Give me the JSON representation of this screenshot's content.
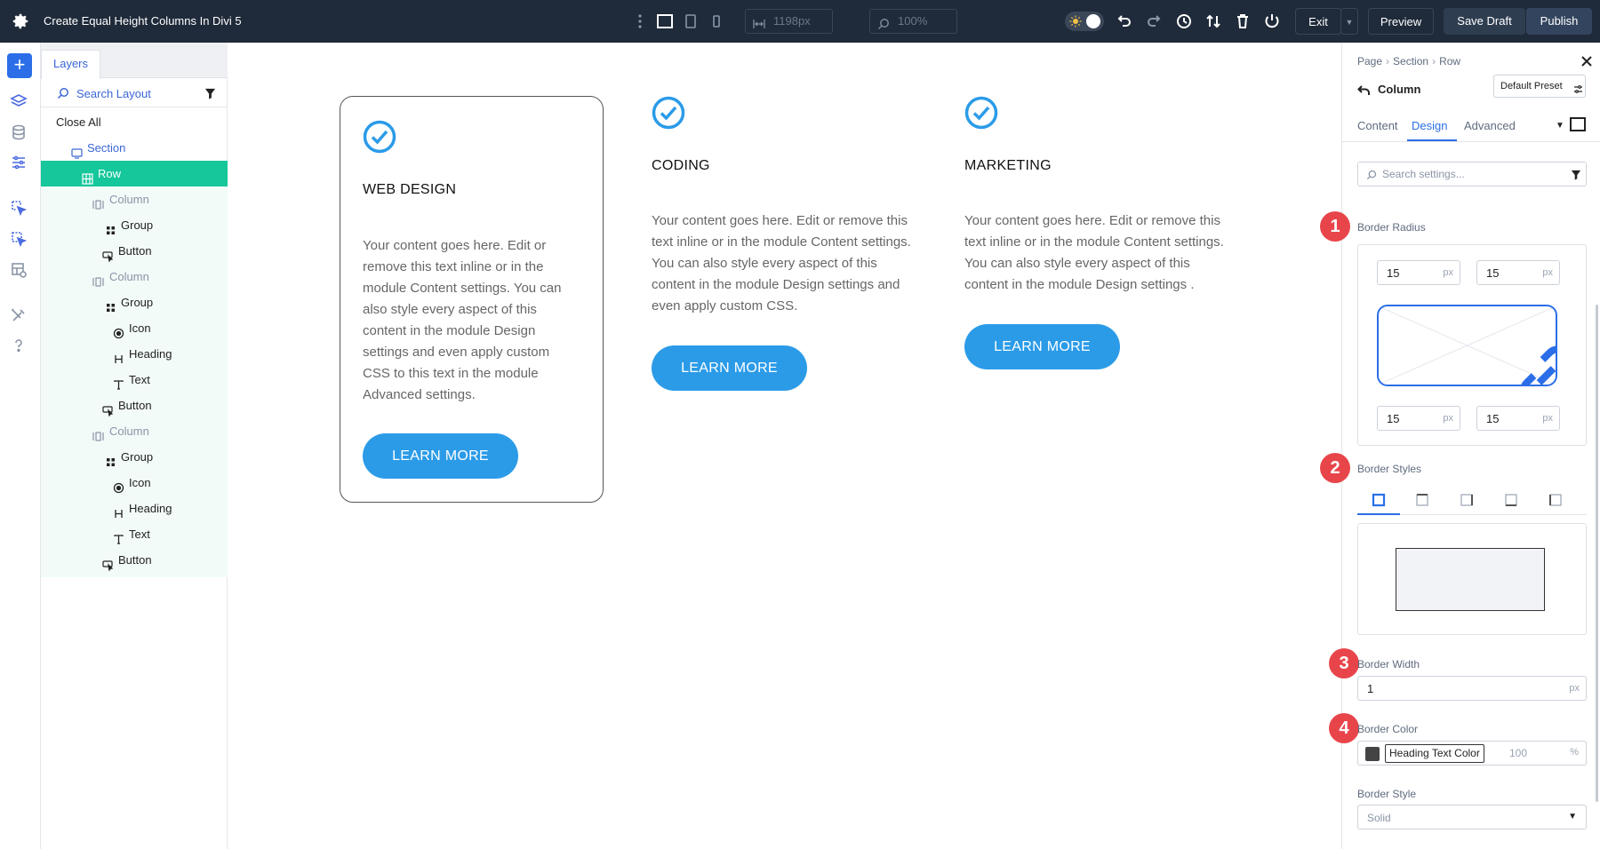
{
  "topbar": {
    "title": "Create Equal Height Columns In Divi 5",
    "width_value": "1198px",
    "zoom_value": "100%",
    "exit_label": "Exit",
    "preview_label": "Preview",
    "save_draft_label": "Save Draft",
    "publish_label": "Publish"
  },
  "layers": {
    "tab_label": "Layers",
    "search_placeholder": "Search Layout",
    "tree": [
      {
        "label": "Close All",
        "type": "close"
      },
      {
        "label": "Section",
        "type": "section"
      },
      {
        "label": "Row",
        "type": "row"
      },
      {
        "label": "Column",
        "type": "column"
      },
      {
        "label": "Group",
        "type": "group"
      },
      {
        "label": "Button",
        "type": "button"
      },
      {
        "label": "Column",
        "type": "column"
      },
      {
        "label": "Group",
        "type": "group"
      },
      {
        "label": "Icon",
        "type": "icon"
      },
      {
        "label": "Heading",
        "type": "heading"
      },
      {
        "label": "Text",
        "type": "text"
      },
      {
        "label": "Button",
        "type": "button"
      },
      {
        "label": "Column",
        "type": "column"
      },
      {
        "label": "Group",
        "type": "group"
      },
      {
        "label": "Icon",
        "type": "icon"
      },
      {
        "label": "Heading",
        "type": "heading"
      },
      {
        "label": "Text",
        "type": "text"
      },
      {
        "label": "Button",
        "type": "button"
      }
    ]
  },
  "canvas": {
    "cards": [
      {
        "title": "WEB DESIGN",
        "text": "Your content goes here. Edit or remove this text inline or in the module Content settings. You can also style every aspect of this content in the module Design settings and even apply custom CSS to this text in the module Advanced settings.",
        "button": "LEARN MORE"
      },
      {
        "title": "CODING",
        "text": "Your content goes here. Edit or remove this text inline or in the module Content settings. You can also style every aspect of this content in the module Design settings and even apply custom CSS.",
        "button": "LEARN MORE"
      },
      {
        "title": "MARKETING",
        "text": "Your content goes here. Edit or remove this text inline or in the module Content settings. You can also style every aspect of this content in the module Design settings .",
        "button": "LEARN MORE"
      }
    ],
    "accent_color": "#2b9be8"
  },
  "settings": {
    "breadcrumb": [
      "Page",
      "Section",
      "Row"
    ],
    "title": "Column",
    "preset": "Default Preset",
    "tabs": {
      "content": "Content",
      "design": "Design",
      "advanced": "Advanced"
    },
    "search_placeholder": "Search settings...",
    "border_radius": {
      "label": "Border Radius",
      "top_left": "15",
      "top_right": "15",
      "bottom_left": "15",
      "bottom_right": "15",
      "unit": "px"
    },
    "border_styles_label": "Border Styles",
    "border_width": {
      "label": "Border Width",
      "value": "1",
      "unit": "px"
    },
    "border_color": {
      "label": "Border Color",
      "variable": "Heading Text Color",
      "opacity": "100",
      "unit": "%"
    },
    "border_style": {
      "label": "Border Style",
      "value": "Solid"
    },
    "badges": [
      "1",
      "2",
      "3",
      "4"
    ],
    "badge_color": "#e8454b"
  }
}
